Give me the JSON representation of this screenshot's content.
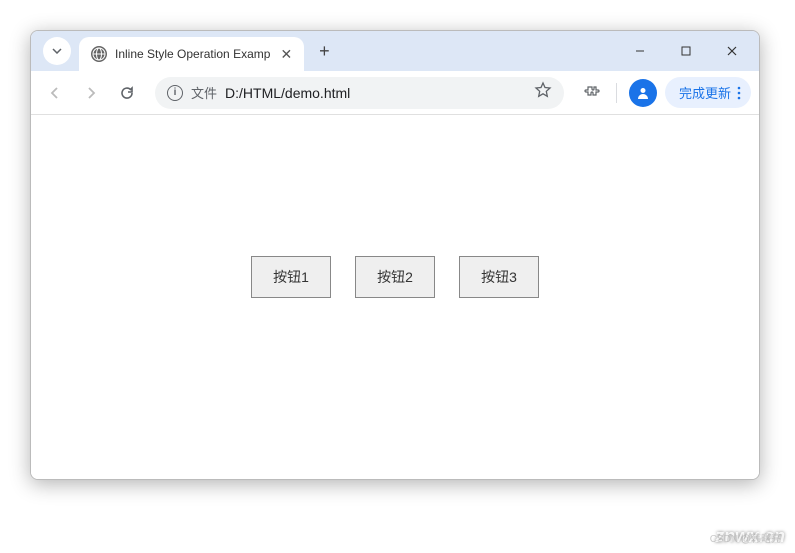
{
  "tab": {
    "title": "Inline Style Operation Examp",
    "favicon": "🌐"
  },
  "address": {
    "type_label": "文件",
    "url": "D:/HTML/demo.html"
  },
  "toolbar": {
    "update_label": "完成更新"
  },
  "content": {
    "buttons": [
      "按钮1",
      "按钮2",
      "按钮3"
    ]
  },
  "watermark": {
    "main": "znwx.cn",
    "sub": "CSDN @韩曙亮"
  }
}
